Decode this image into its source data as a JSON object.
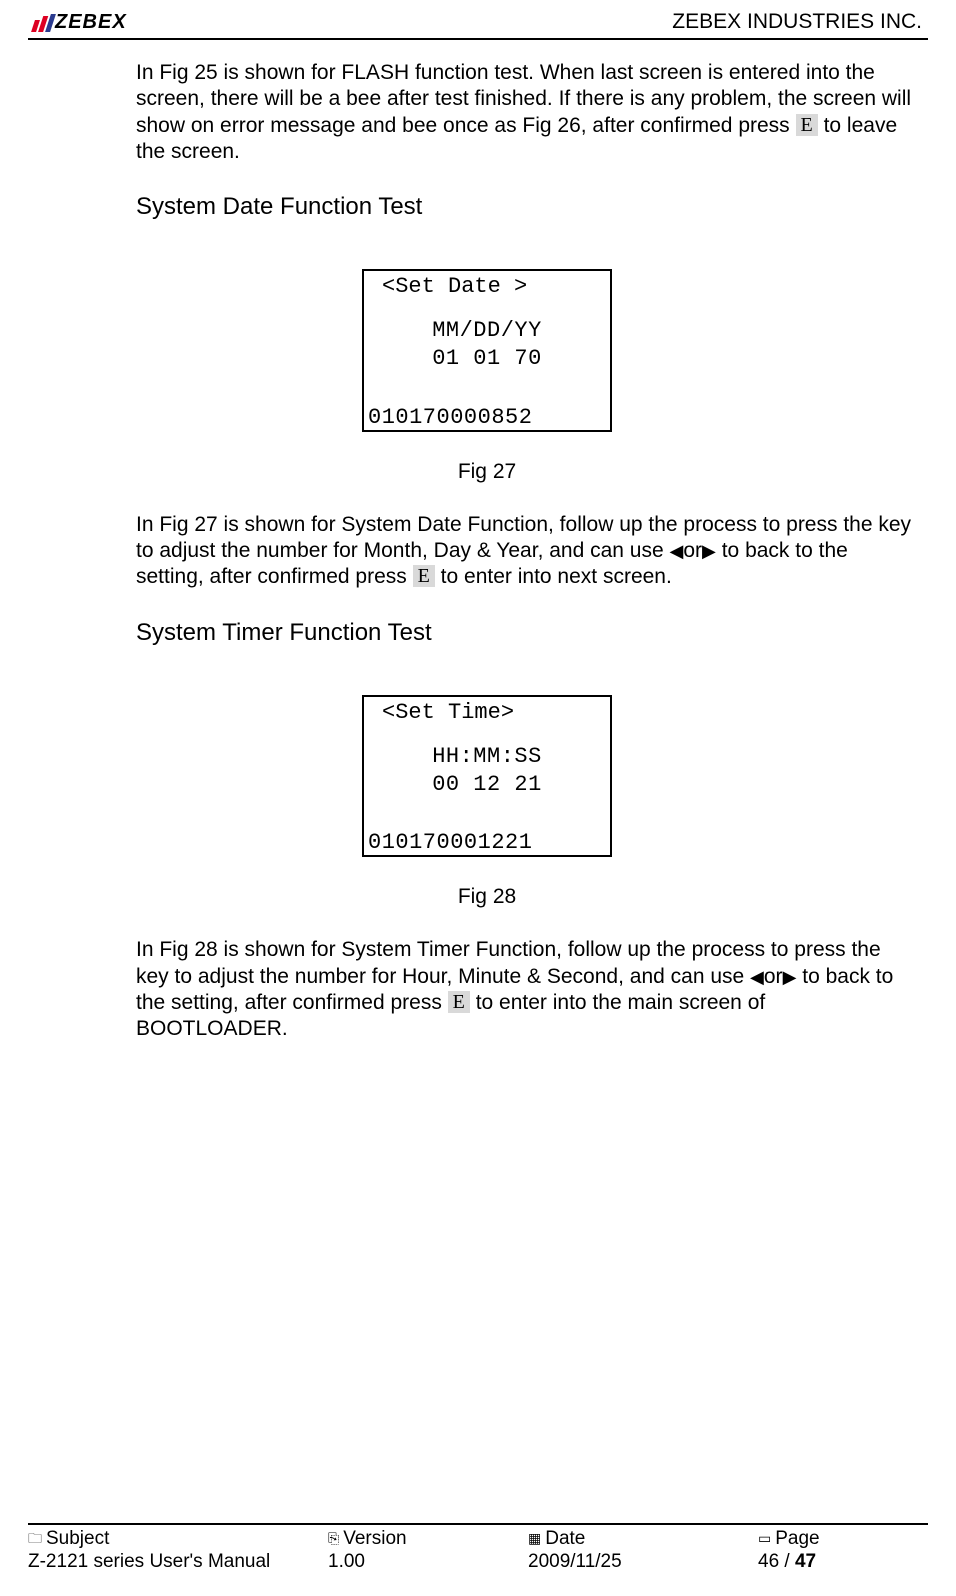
{
  "header": {
    "logo_text": "ZEBEX",
    "company": "ZEBEX INDUSTRIES INC."
  },
  "body": {
    "para1_a": "In Fig 25 is shown for FLASH function test. When last screen is entered into the screen, there will be a bee after test finished. If there is any problem, the screen will show on error message and bee once as Fig 26, after confirmed press ",
    "key_e": "E",
    "para1_b": " to leave the screen.",
    "heading1": "System Date Function Test",
    "fig27": {
      "screen_title": "<Set Date >",
      "line1": "MM/DD/YY",
      "line2": "01  01  70",
      "barcode": "010170000852",
      "caption": "Fig 27"
    },
    "para2_a": "In Fig 27 is shown for System Date Function, follow up the process to press the key to adjust the number for Month, Day & Year, and can use ",
    "or_word": "or",
    "para2_b": " to back to the setting, after confirmed press ",
    "para2_c": " to enter into next screen.",
    "heading2": "System Timer Function Test",
    "fig28": {
      "screen_title": "<Set Time>",
      "line1": "HH:MM:SS",
      "line2": "00  12  21",
      "barcode": "010170001221",
      "caption": "Fig 28"
    },
    "para3_a": "In Fig 28 is shown for System Timer Function, follow up the process to press the key to adjust the number for Hour, Minute & Second, and can use ",
    "para3_b": " to back to the setting, after confirmed press ",
    "para3_c": " to enter into the main screen of BOOTLOADER."
  },
  "footer": {
    "labels": {
      "subject": "Subject",
      "version": "Version",
      "date": "Date",
      "page": "Page"
    },
    "values": {
      "subject": "Z-2121 series User's Manual",
      "version": "1.00",
      "date": "2009/11/25",
      "page_current": "46",
      "page_sep": " / ",
      "page_total": "47"
    }
  }
}
